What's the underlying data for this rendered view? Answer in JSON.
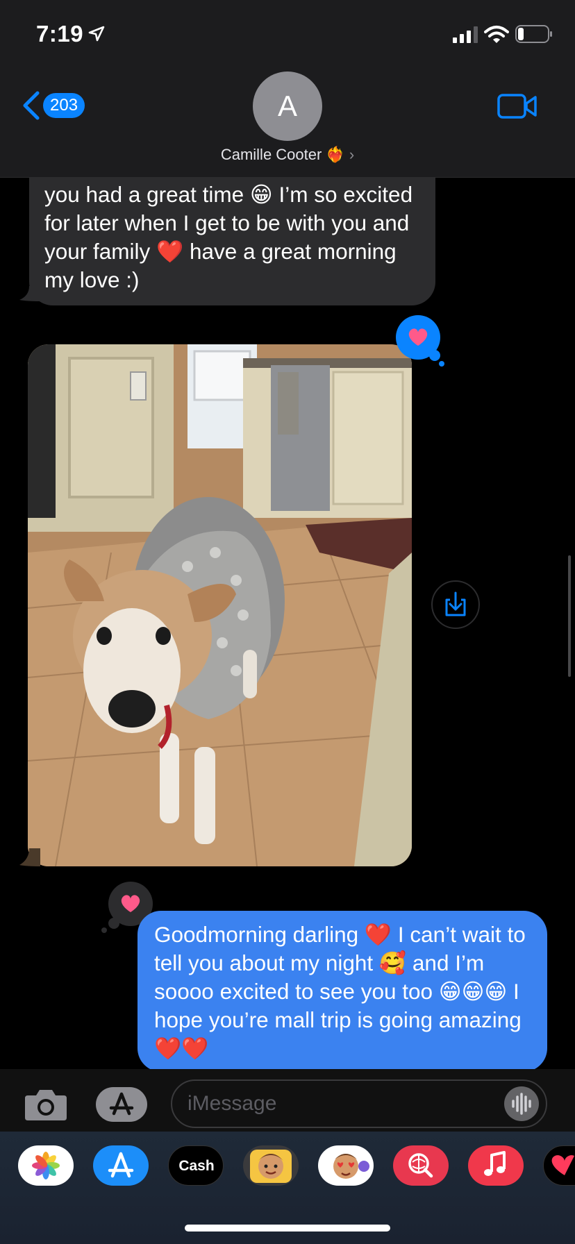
{
  "status_bar": {
    "time": "7:19",
    "icons": [
      "location-arrow-icon",
      "cellular-signal-icon",
      "wifi-icon",
      "battery-icon"
    ]
  },
  "header": {
    "back_count": "203",
    "avatar_initial": "A",
    "contact_name": "Camille Cooter ❤️‍🔥",
    "contact_chevron": "›",
    "icons": [
      "back-chevron-icon",
      "facetime-video-icon"
    ]
  },
  "messages": {
    "incoming_text": "you had a great time 😁 I’m so excited for later when I get to be with you and your family ❤️ have a great morning my love :)",
    "photo": {
      "subject": "dog in sweater standing on kitchen tile floor"
    },
    "outgoing_text": "Goodmorning darling ❤️ I can’t wait to tell you about my night 🥰 and I’m soooo excited to see you too 😁😁😁 I hope you’re mall trip is going amazing ❤️❤️",
    "reactions": [
      "heart-reaction-icon",
      "heart-reaction-icon"
    ],
    "save_icon": "save-to-photos-icon"
  },
  "compose": {
    "placeholder": "iMessage",
    "icons": [
      "camera-icon",
      "app-store-icon",
      "dictation-waveform-icon"
    ]
  },
  "app_drawer": {
    "cash_label": "Cash",
    "apps": [
      "photos-app-icon",
      "app-store-app-icon",
      "apple-cash-app-icon",
      "memoji-app-icon",
      "animoji-app-icon",
      "images-search-app-icon",
      "music-app-icon",
      "digital-touch-app-icon"
    ]
  },
  "colors": {
    "accent_blue": "#0a84ff",
    "outgoing_bubble": "#3b82f0",
    "incoming_bubble": "#2c2c2e",
    "heart_pink": "#ff5a8a"
  }
}
